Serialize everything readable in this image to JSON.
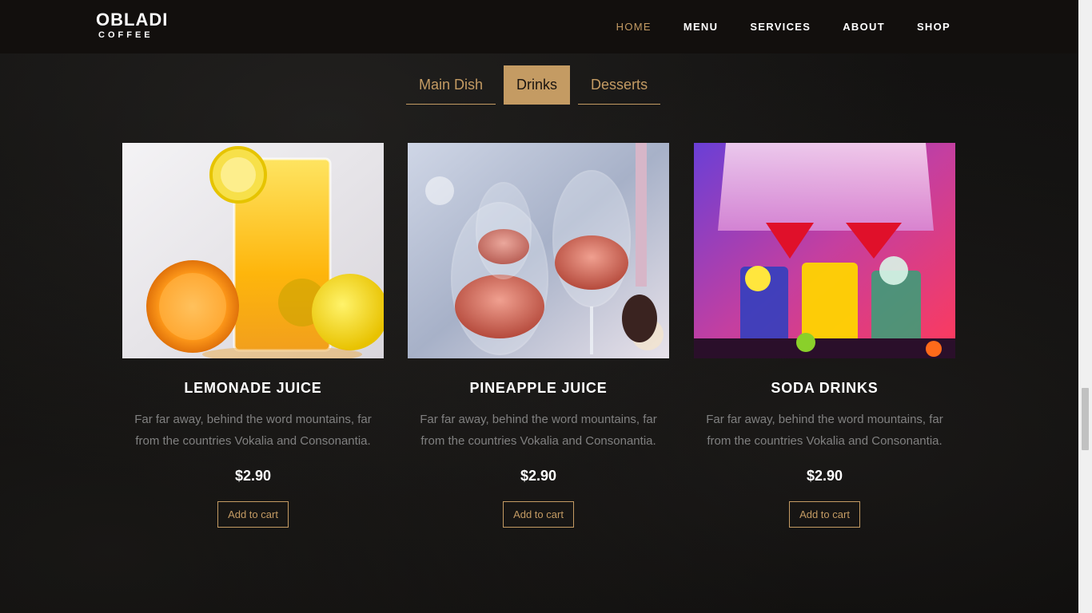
{
  "brand": {
    "name": "OBLADI",
    "sub": "COFFEE"
  },
  "nav": [
    {
      "label": "HOME",
      "active": true
    },
    {
      "label": "MENU",
      "active": false
    },
    {
      "label": "SERVICES",
      "active": false
    },
    {
      "label": "ABOUT",
      "active": false
    },
    {
      "label": "SHOP",
      "active": false
    }
  ],
  "tabs": [
    {
      "label": "Main Dish",
      "active": false
    },
    {
      "label": "Drinks",
      "active": true
    },
    {
      "label": "Desserts",
      "active": false
    }
  ],
  "products": [
    {
      "title": "LEMONADE JUICE",
      "description": "Far far away, behind the word mountains, far from the countries Vokalia and Consonantia.",
      "price": "$2.90",
      "button": "Add to cart"
    },
    {
      "title": "PINEAPPLE JUICE",
      "description": "Far far away, behind the word mountains, far from the countries Vokalia and Consonantia.",
      "price": "$2.90",
      "button": "Add to cart"
    },
    {
      "title": "SODA DRINKS",
      "description": "Far far away, behind the word mountains, far from the countries Vokalia and Consonantia.",
      "price": "$2.90",
      "button": "Add to cart"
    }
  ],
  "colors": {
    "accent": "#c49b63",
    "background": "#0f0e0d",
    "navbar": "#120f0d"
  }
}
